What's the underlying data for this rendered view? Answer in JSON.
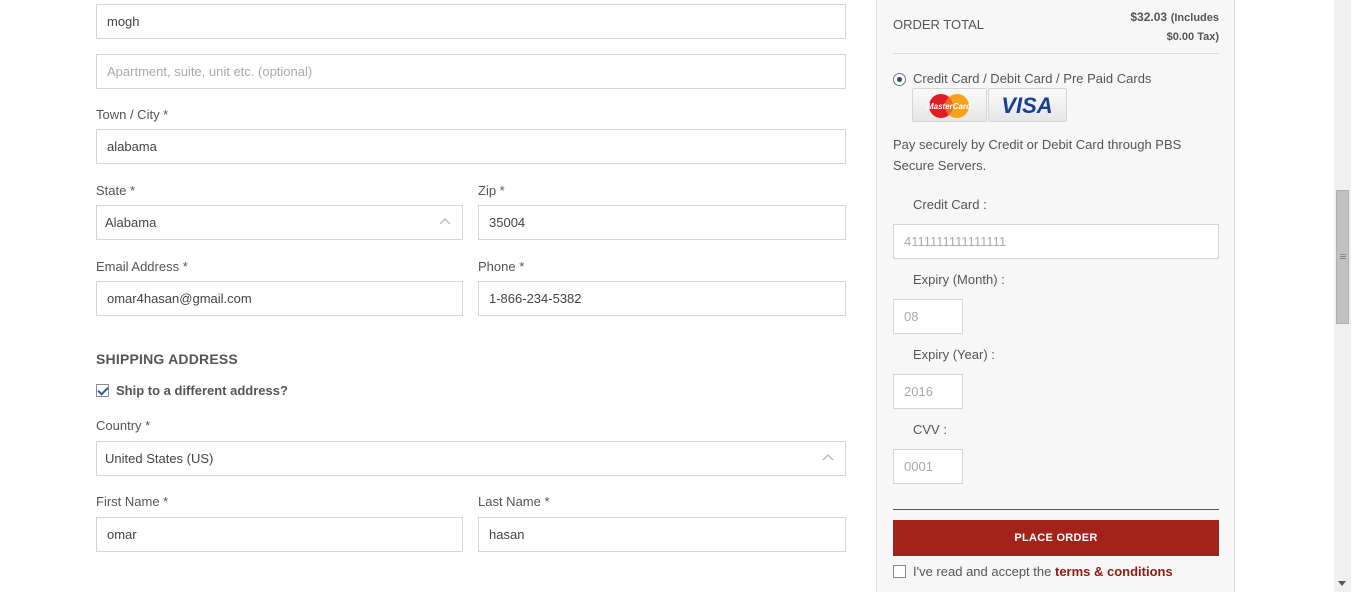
{
  "billing": {
    "address1_value": "mogh",
    "address2_placeholder": "Apartment, suite, unit etc. (optional)",
    "city_label": "Town / City *",
    "city_value": "alabama",
    "state_label": "State *",
    "state_value": "Alabama",
    "zip_label": "Zip *",
    "zip_value": "35004",
    "email_label": "Email Address *",
    "email_value": "omar4hasan@gmail.com",
    "phone_label": "Phone *",
    "phone_value": "1-866-234-5382"
  },
  "shipping": {
    "title": "SHIPPING ADDRESS",
    "different_label": "Ship to a different address?",
    "different_checked": true,
    "country_label": "Country *",
    "country_value": "United States (US)",
    "first_name_label": "First Name *",
    "first_name_value": "omar",
    "last_name_label": "Last Name *",
    "last_name_value": "hasan"
  },
  "order": {
    "total_label": "ORDER TOTAL",
    "total_amount": "$32.03",
    "total_includes": "(Includes",
    "total_tax": "$0.00 Tax)",
    "payment_method_label": "Credit Card / Debit Card / Pre Paid Cards",
    "payment_description": "Pay securely by Credit or Debit Card through PBS Secure Servers.",
    "card_logos": [
      "MasterCard",
      "VISA"
    ],
    "credit_card_label": "Credit Card :",
    "credit_card_placeholder": "4111111111111111",
    "expiry_month_label": "Expiry (Month) :",
    "expiry_month_placeholder": "08",
    "expiry_year_label": "Expiry (Year) :",
    "expiry_year_placeholder": "2016",
    "cvv_label": "CVV :",
    "cvv_placeholder": "0001",
    "place_order_label": "PLACE ORDER",
    "terms_prefix": "I've read and accept the",
    "terms_link": "terms & conditions"
  },
  "colors": {
    "accent": "#a2231a",
    "link": "#8e1b12",
    "radio": "#2a4d7e"
  }
}
